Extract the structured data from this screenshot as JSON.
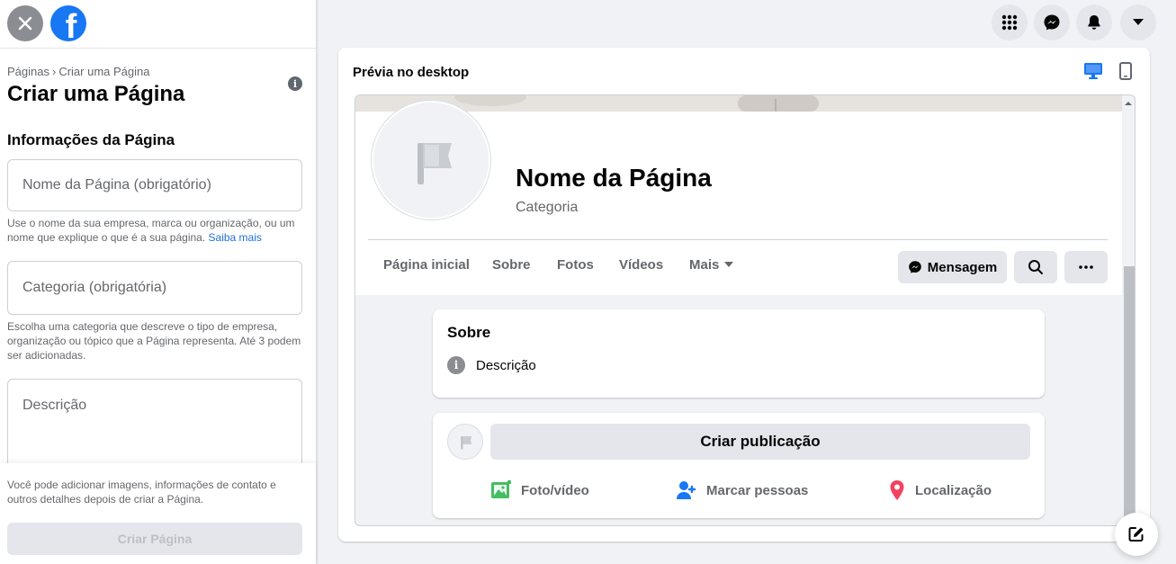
{
  "left_panel": {
    "breadcrumb": {
      "parent": "Páginas",
      "separator": "›",
      "current": "Criar uma Página"
    },
    "title": "Criar uma Página",
    "section_title": "Informações da Página",
    "name_field": {
      "placeholder": "Nome da Página (obrigatório)",
      "value": ""
    },
    "name_hint": "Use o nome da sua empresa, marca ou organização, ou um nome que explique o que é a sua página.",
    "name_hint_link": "Saiba mais",
    "category_field": {
      "placeholder": "Categoria (obrigatória)",
      "value": ""
    },
    "category_hint": "Escolha uma categoria que descreve o tipo de empresa, organização ou tópico que a Página representa. Até 3 podem ser adicionadas.",
    "description_field": {
      "placeholder": "Descrição",
      "value": ""
    },
    "bottom_note": "Você pode adicionar imagens, informações de contato e outros detalhes depois de criar a Página.",
    "create_button": "Criar Página"
  },
  "top_icons": [
    "menu-grid-icon",
    "messenger-icon",
    "notifications-bell-icon",
    "account-caret-icon"
  ],
  "preview": {
    "title": "Prévia no desktop",
    "page_name": "Nome da Página",
    "page_category": "Categoria",
    "tabs": [
      "Página inicial",
      "Sobre",
      "Fotos",
      "Vídeos",
      "Mais"
    ],
    "message_button": "Mensagem",
    "about_card": {
      "title": "Sobre",
      "description": "Descrição"
    },
    "post_card": {
      "create_post": "Criar publicação",
      "actions": [
        "Foto/vídeo",
        "Marcar pessoas",
        "Localização"
      ]
    }
  },
  "colors": {
    "brand": "#1877f2",
    "background": "#f0f2f5",
    "button_gray": "#e4e6eb",
    "photo_green": "#45bd62",
    "tag_blue": "#1877f2",
    "location_red": "#f3425f"
  }
}
